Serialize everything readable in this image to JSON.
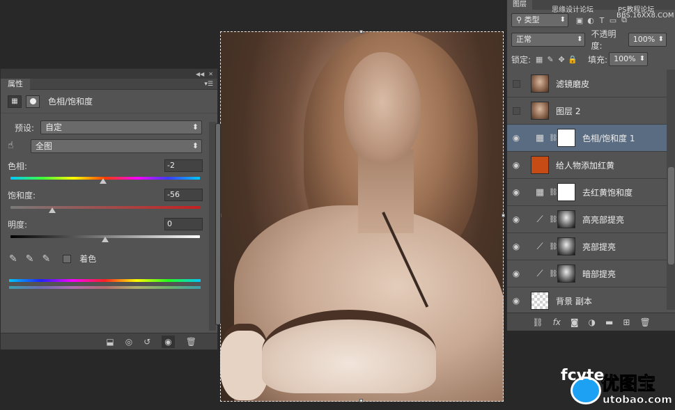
{
  "properties_panel": {
    "tab": "属性",
    "title": "色相/饱和度",
    "preset_label": "预设:",
    "preset_value": "自定",
    "channel_value": "全图",
    "hue": {
      "label": "色相:",
      "value": "-2",
      "level": 0.49
    },
    "saturation": {
      "label": "饱和度:",
      "value": "-56",
      "level": 0.22
    },
    "lightness": {
      "label": "明度:",
      "value": "0",
      "level": 0.5
    },
    "colorize_label": "着色",
    "colorize_checked": false
  },
  "layers_panel": {
    "tab": "图层",
    "filter_kind": "类型",
    "blend_mode": "正常",
    "opacity_label": "不透明度:",
    "opacity_value": "100%",
    "lock_label": "锁定:",
    "fill_label": "填充:",
    "fill_value": "100%",
    "layers": [
      {
        "name": "滤镜磨皮",
        "visible": false,
        "kind": "photo"
      },
      {
        "name": "图层 2",
        "visible": false,
        "kind": "photo"
      },
      {
        "name": "色相/饱和度 1",
        "visible": true,
        "kind": "adjust-hue",
        "selected": true
      },
      {
        "name": "给人物添加红黄",
        "visible": true,
        "kind": "color",
        "color": "#c64b14"
      },
      {
        "name": "去红黄饱和度",
        "visible": true,
        "kind": "adjust-hue"
      },
      {
        "name": "高亮部提亮",
        "visible": true,
        "kind": "adjust-curves"
      },
      {
        "name": "亮部提亮",
        "visible": true,
        "kind": "adjust-curves"
      },
      {
        "name": "暗部提亮",
        "visible": true,
        "kind": "adjust-curves"
      },
      {
        "name": "背景 副本",
        "visible": true,
        "kind": "transparent"
      }
    ]
  },
  "watermarks": {
    "site1": "思缘设计论坛",
    "site2": "PS教程论坛",
    "site3": "BBS.16XX8.COM",
    "logo_brand": "fcvte",
    "logo_cn": "优图宝",
    "logo_url": "utobao.com"
  },
  "colors": {
    "panel_bg": "#535353",
    "workspace_bg": "#282828",
    "selected_layer": "#5a6c82",
    "fill_layer_color": "#c64b14"
  }
}
